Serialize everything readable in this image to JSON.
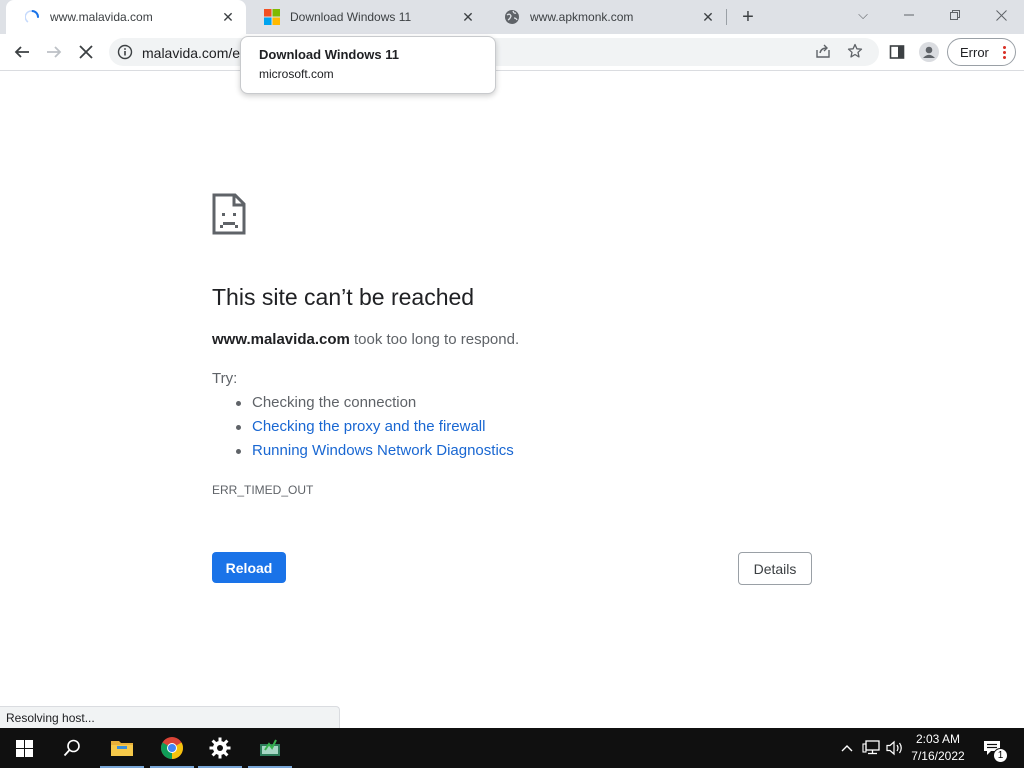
{
  "browser": {
    "tabs": [
      {
        "title": "www.malavida.com",
        "favicon": "loading-spinner-icon",
        "active": true
      },
      {
        "title": "Download Windows 11",
        "favicon": "microsoft-logo-icon",
        "active": false
      },
      {
        "title": "www.apkmonk.com",
        "favicon": "globe-icon",
        "active": false
      }
    ],
    "new_tab_label": "+",
    "window_controls": {
      "tab_search": "⌵",
      "minimize": "—",
      "restore": "❐",
      "close": "✕"
    },
    "toolbar": {
      "url": "malavida.com/e",
      "profile_chip_label": "Error"
    },
    "hover_card": {
      "title": "Download Windows 11",
      "domain": "microsoft.com"
    }
  },
  "error_page": {
    "heading": "This site can’t be reached",
    "host": "www.malavida.com",
    "message": " took too long to respond.",
    "try_label": "Try:",
    "suggestions": [
      {
        "text": "Checking the connection",
        "link": false
      },
      {
        "text": "Checking the proxy and the firewall",
        "link": true
      },
      {
        "text": "Running Windows Network Diagnostics",
        "link": true
      }
    ],
    "error_code": "ERR_TIMED_OUT",
    "reload_label": "Reload",
    "details_label": "Details"
  },
  "status_bar": {
    "text": "Resolving host..."
  },
  "taskbar": {
    "items": [
      "start-icon",
      "search-icon",
      "file-explorer-icon",
      "chrome-icon",
      "settings-icon",
      "app-icon"
    ],
    "time": "2:03 AM",
    "date": "7/16/2022",
    "notification_count": "1"
  },
  "colors": {
    "accent_blue": "#1a73e8",
    "link_blue": "#1967d2",
    "tab_strip": "#dee1e6",
    "taskbar": "#101010",
    "error_dots": "#d93025"
  }
}
